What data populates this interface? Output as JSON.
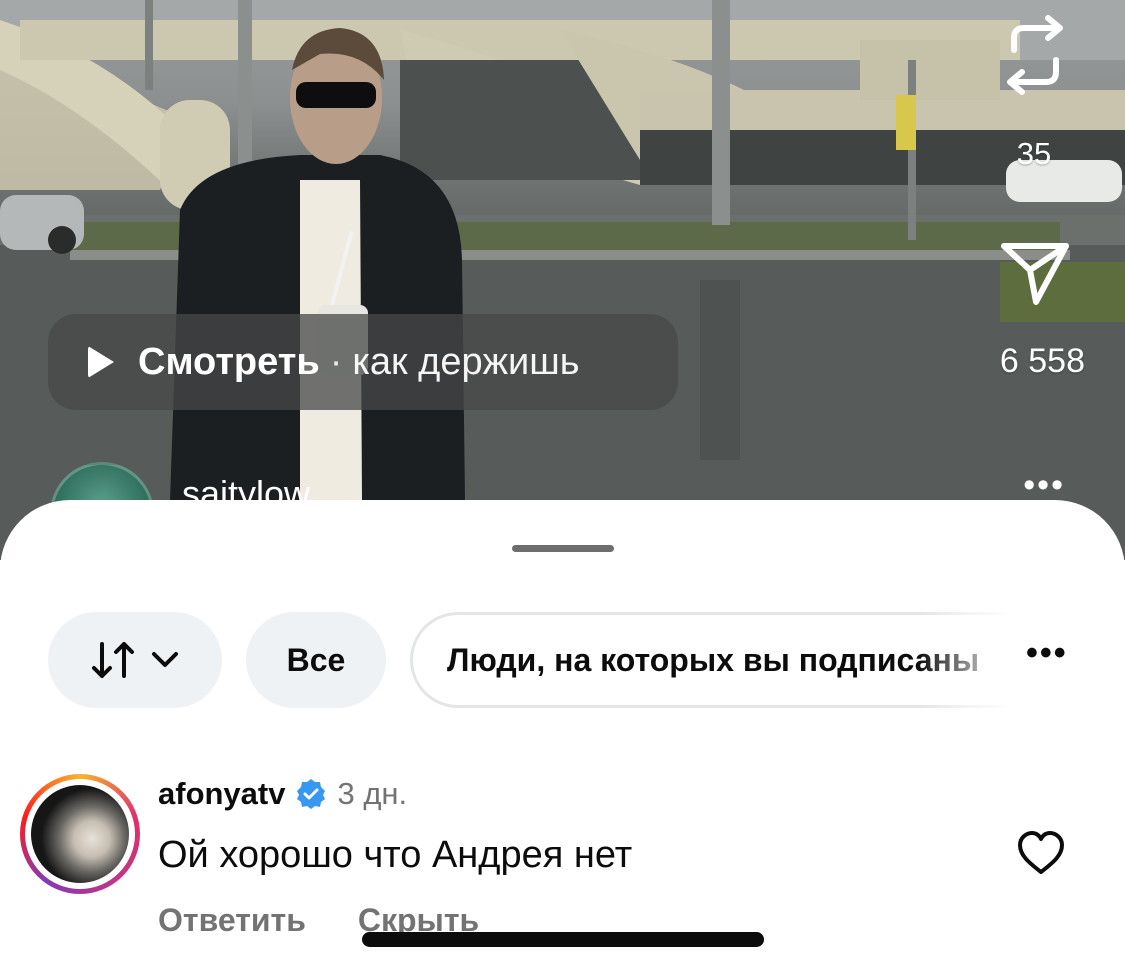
{
  "video": {
    "repost_count": "35",
    "send_count": "6 558",
    "watch_label": "Смотреть",
    "watch_separator": "·",
    "watch_sound": "как держишь",
    "author": "saitylow",
    "more": "•••"
  },
  "filters": {
    "all_label": "Все",
    "following_label": "Люди, на которых вы подписаны",
    "more": "•••"
  },
  "comment": {
    "username": "afonyatv",
    "verified": true,
    "time": "3 дн.",
    "text": "Ой хорошо что Андрея нет",
    "reply_label": "Ответить",
    "hide_label": "Скрыть"
  },
  "icons": [
    "repost-icon",
    "send-icon",
    "play-icon",
    "sort-icon",
    "chevron-down-icon",
    "verified-icon",
    "heart-icon"
  ],
  "colors": {
    "verified": "#3897f0",
    "secondary_text": "#737373",
    "chip_bg": "#eff2f5"
  }
}
